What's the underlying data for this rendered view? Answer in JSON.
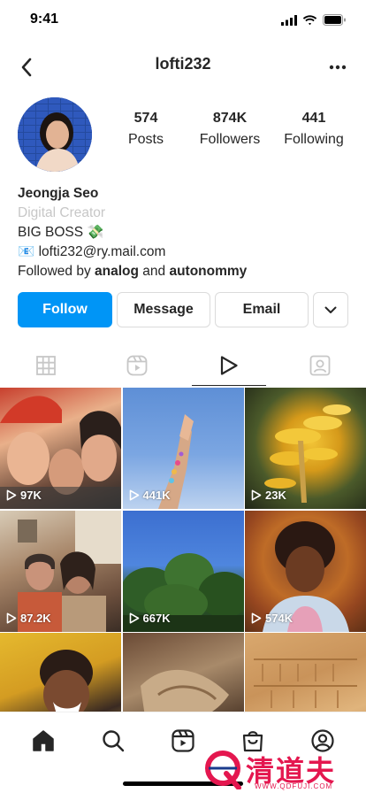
{
  "status_bar": {
    "time": "9:41"
  },
  "nav": {
    "username": "lofti232"
  },
  "profile": {
    "stats": [
      {
        "value": "574",
        "label": "Posts"
      },
      {
        "value": "874K",
        "label": "Followers"
      },
      {
        "value": "441",
        "label": "Following"
      }
    ],
    "name": "Jeongja Seo",
    "category": "Digital Creator",
    "bio_line": "BIG BOSS 💸",
    "email_line": "📧 lofti232@ry.mail.com",
    "followed_prefix": "Followed by ",
    "followed_user1": "analog",
    "followed_and": " and ",
    "followed_user2": "autonommy"
  },
  "actions": {
    "follow_label": "Follow",
    "message_label": "Message",
    "email_label": "Email"
  },
  "tabs": [
    {
      "icon": "grid-icon",
      "active": false
    },
    {
      "icon": "reels-icon",
      "active": false
    },
    {
      "icon": "play-icon",
      "active": true
    },
    {
      "icon": "tagged-icon",
      "active": false
    }
  ],
  "grid_items": [
    {
      "views": "97K"
    },
    {
      "views": "441K"
    },
    {
      "views": "23K"
    },
    {
      "views": "87.2K"
    },
    {
      "views": "667K"
    },
    {
      "views": "574K"
    },
    {
      "views": ""
    },
    {
      "views": ""
    },
    {
      "views": ""
    }
  ],
  "bottom_nav": [
    {
      "icon": "home-icon"
    },
    {
      "icon": "search-icon"
    },
    {
      "icon": "reels-icon"
    },
    {
      "icon": "shop-icon"
    },
    {
      "icon": "profile-icon"
    }
  ],
  "colors": {
    "accent": "#0095f6",
    "text": "#262626",
    "muted": "#c7c7c7"
  },
  "watermark": {
    "text": "清道夫",
    "sub": "WWW.QDFUJI.COM"
  }
}
